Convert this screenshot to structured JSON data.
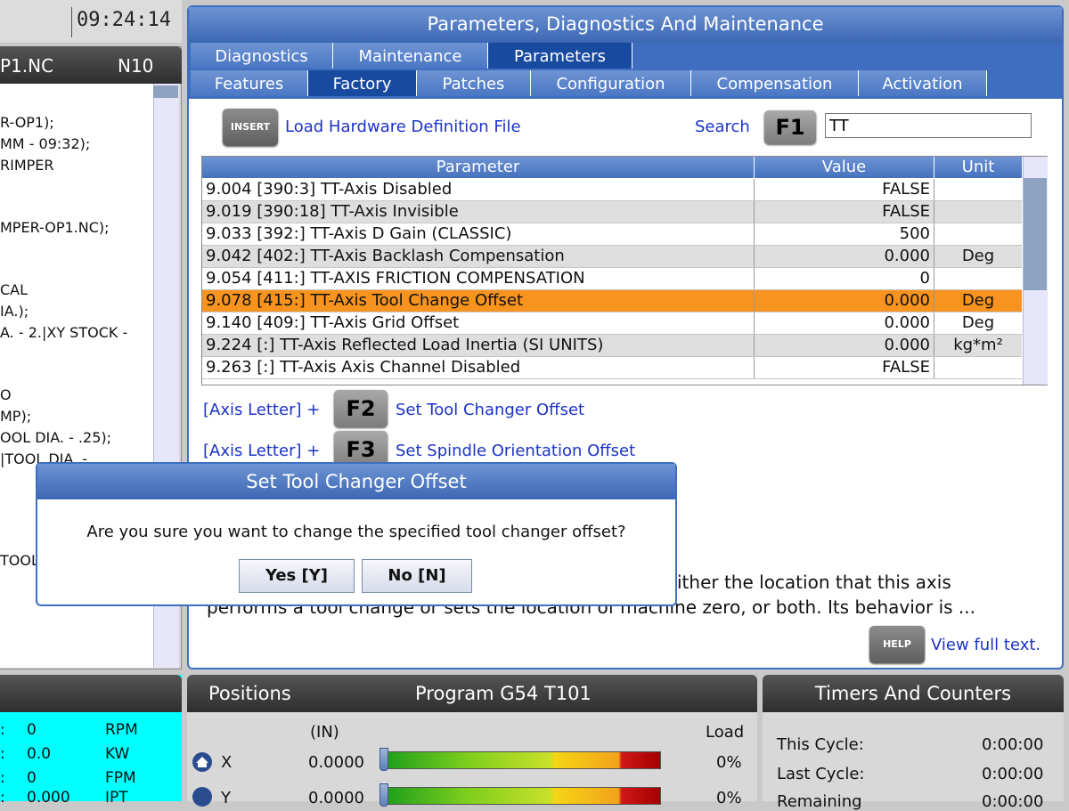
{
  "clock": {
    "time": "09:24:14"
  },
  "program": {
    "name": "P1.NC",
    "n": "N10",
    "lines": [
      "R-OP1);",
      "MM - 09:32);",
      "RIMPER",
      "MPER-OP1.NC);",
      "CAL",
      "IA.);",
      "A. - 2.|XY STOCK -",
      "O",
      "MP);",
      "OOL DIA. - .25);",
      "|TOOL DIA. -",
      "TOOL"
    ]
  },
  "main": {
    "title": "Parameters, Diagnostics And Maintenance",
    "tabs_row1": [
      {
        "label": "Diagnostics",
        "active": false
      },
      {
        "label": "Maintenance",
        "active": false
      },
      {
        "label": "Parameters",
        "active": true
      }
    ],
    "tabs_row2": [
      {
        "label": "Features",
        "active": false
      },
      {
        "label": "Factory",
        "active": true
      },
      {
        "label": "Patches",
        "active": false
      },
      {
        "label": "Configuration",
        "active": false
      },
      {
        "label": "Compensation",
        "active": false
      },
      {
        "label": "Activation",
        "active": false
      }
    ],
    "insert_key": "INSERT",
    "load_hw_label": "Load Hardware Definition File",
    "search_label": "Search",
    "f1_key": "F1",
    "search_value": "TT",
    "table": {
      "headers": [
        "Parameter",
        "Value",
        "Unit"
      ],
      "rows": [
        {
          "param": "9.004 [390:3] TT-Axis Disabled",
          "value": "FALSE",
          "unit": ""
        },
        {
          "param": "9.019 [390:18] TT-Axis Invisible",
          "value": "FALSE",
          "unit": ""
        },
        {
          "param": "9.033 [392:] TT-Axis D Gain (CLASSIC)",
          "value": "500",
          "unit": ""
        },
        {
          "param": "9.042 [402:] TT-Axis Backlash Compensation",
          "value": "0.000",
          "unit": "Deg"
        },
        {
          "param": "9.054 [411:] TT-AXIS FRICTION COMPENSATION",
          "value": "0",
          "unit": ""
        },
        {
          "param": "9.078 [415:] TT-Axis Tool Change Offset",
          "value": "0.000",
          "unit": "Deg",
          "selected": true
        },
        {
          "param": "9.140 [409:] TT-Axis Grid Offset",
          "value": "0.000",
          "unit": "Deg"
        },
        {
          "param": "9.224 [:] TT-Axis Reflected Load Inertia (SI UNITS)",
          "value": "0.000",
          "unit": "kg*m²"
        },
        {
          "param": "9.263 [:] TT-Axis Axis Channel Disabled",
          "value": "FALSE",
          "unit": ""
        }
      ]
    },
    "axis_letter": "[Axis Letter] +",
    "f2_key": "F2",
    "f2_label": "Set Tool Changer Offset",
    "f3_key": "F3",
    "f3_label": "Set Spindle Orientation Offset",
    "desc_line1": "ither the location that this axis",
    "desc_line2": "performs a tool change or sets the location of machine zero, or both. Its behavior is ...",
    "help_key": "HELP",
    "view_full": "View full text."
  },
  "modal": {
    "title": "Set Tool Changer Offset",
    "message": "Are you sure you want to change the specified tool changer offset?",
    "yes": "Yes [Y]",
    "no": "No [N]"
  },
  "spindle": {
    "rows": [
      {
        "label": ":",
        "value": "0",
        "unit": "RPM"
      },
      {
        "label": ":",
        "value": "0.0",
        "unit": "KW"
      },
      {
        "label": ":",
        "value": "0",
        "unit": "FPM"
      },
      {
        "label": ":",
        "value": "0.000",
        "unit": "IPT"
      }
    ]
  },
  "positions": {
    "title": "Positions",
    "program_label": "Program G54 T101",
    "units": "(IN)",
    "load_label": "Load",
    "axes": [
      {
        "axis": "X",
        "value": "0.0000",
        "load": "0%",
        "load_fraction": 0.0
      },
      {
        "axis": "Y",
        "value": "0.0000",
        "load": "0%",
        "load_fraction": 0.0
      }
    ]
  },
  "timers": {
    "title": "Timers And Counters",
    "rows": [
      {
        "label": "This Cycle:",
        "value": "0:00:00"
      },
      {
        "label": "Last Cycle:",
        "value": "0:00:00"
      },
      {
        "label": "Remaining",
        "value": "0:00:00"
      }
    ]
  },
  "colors": {
    "accent": "#3d6fc0",
    "selected_row": "#f7931e",
    "link_blue": "#1b32c8",
    "spindle_bg": "#00ffff"
  }
}
